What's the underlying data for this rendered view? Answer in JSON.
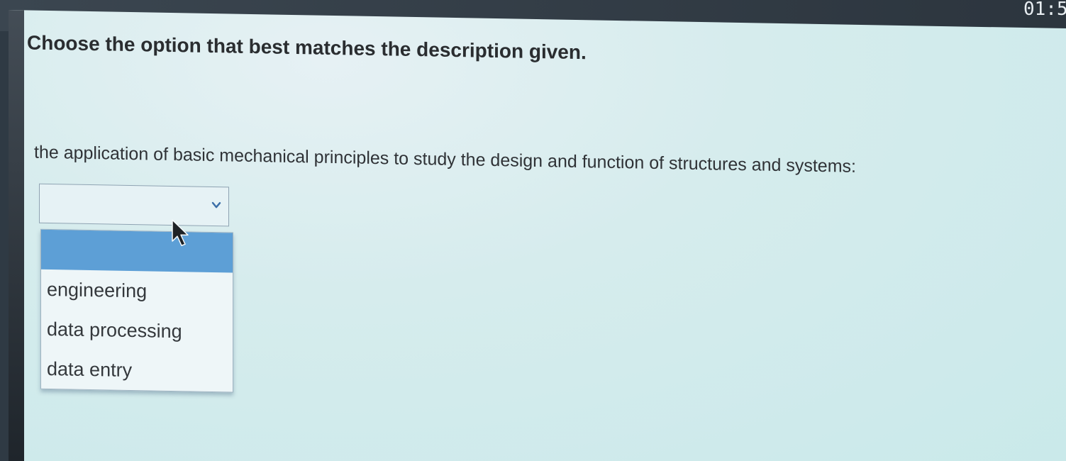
{
  "timer": {
    "text": "01:5"
  },
  "question": {
    "prompt": "Choose the option that best matches the description given.",
    "description": "the application of basic mechanical principles to study the design and function of structures and systems:"
  },
  "select": {
    "selected_value": "",
    "icon": "chevron-down-icon",
    "options": [
      "",
      "engineering",
      "data processing",
      "data entry"
    ]
  },
  "colors": {
    "highlight": "#5d9fd6",
    "chevron": "#3c6fa8",
    "page_background": "#d6eced"
  }
}
